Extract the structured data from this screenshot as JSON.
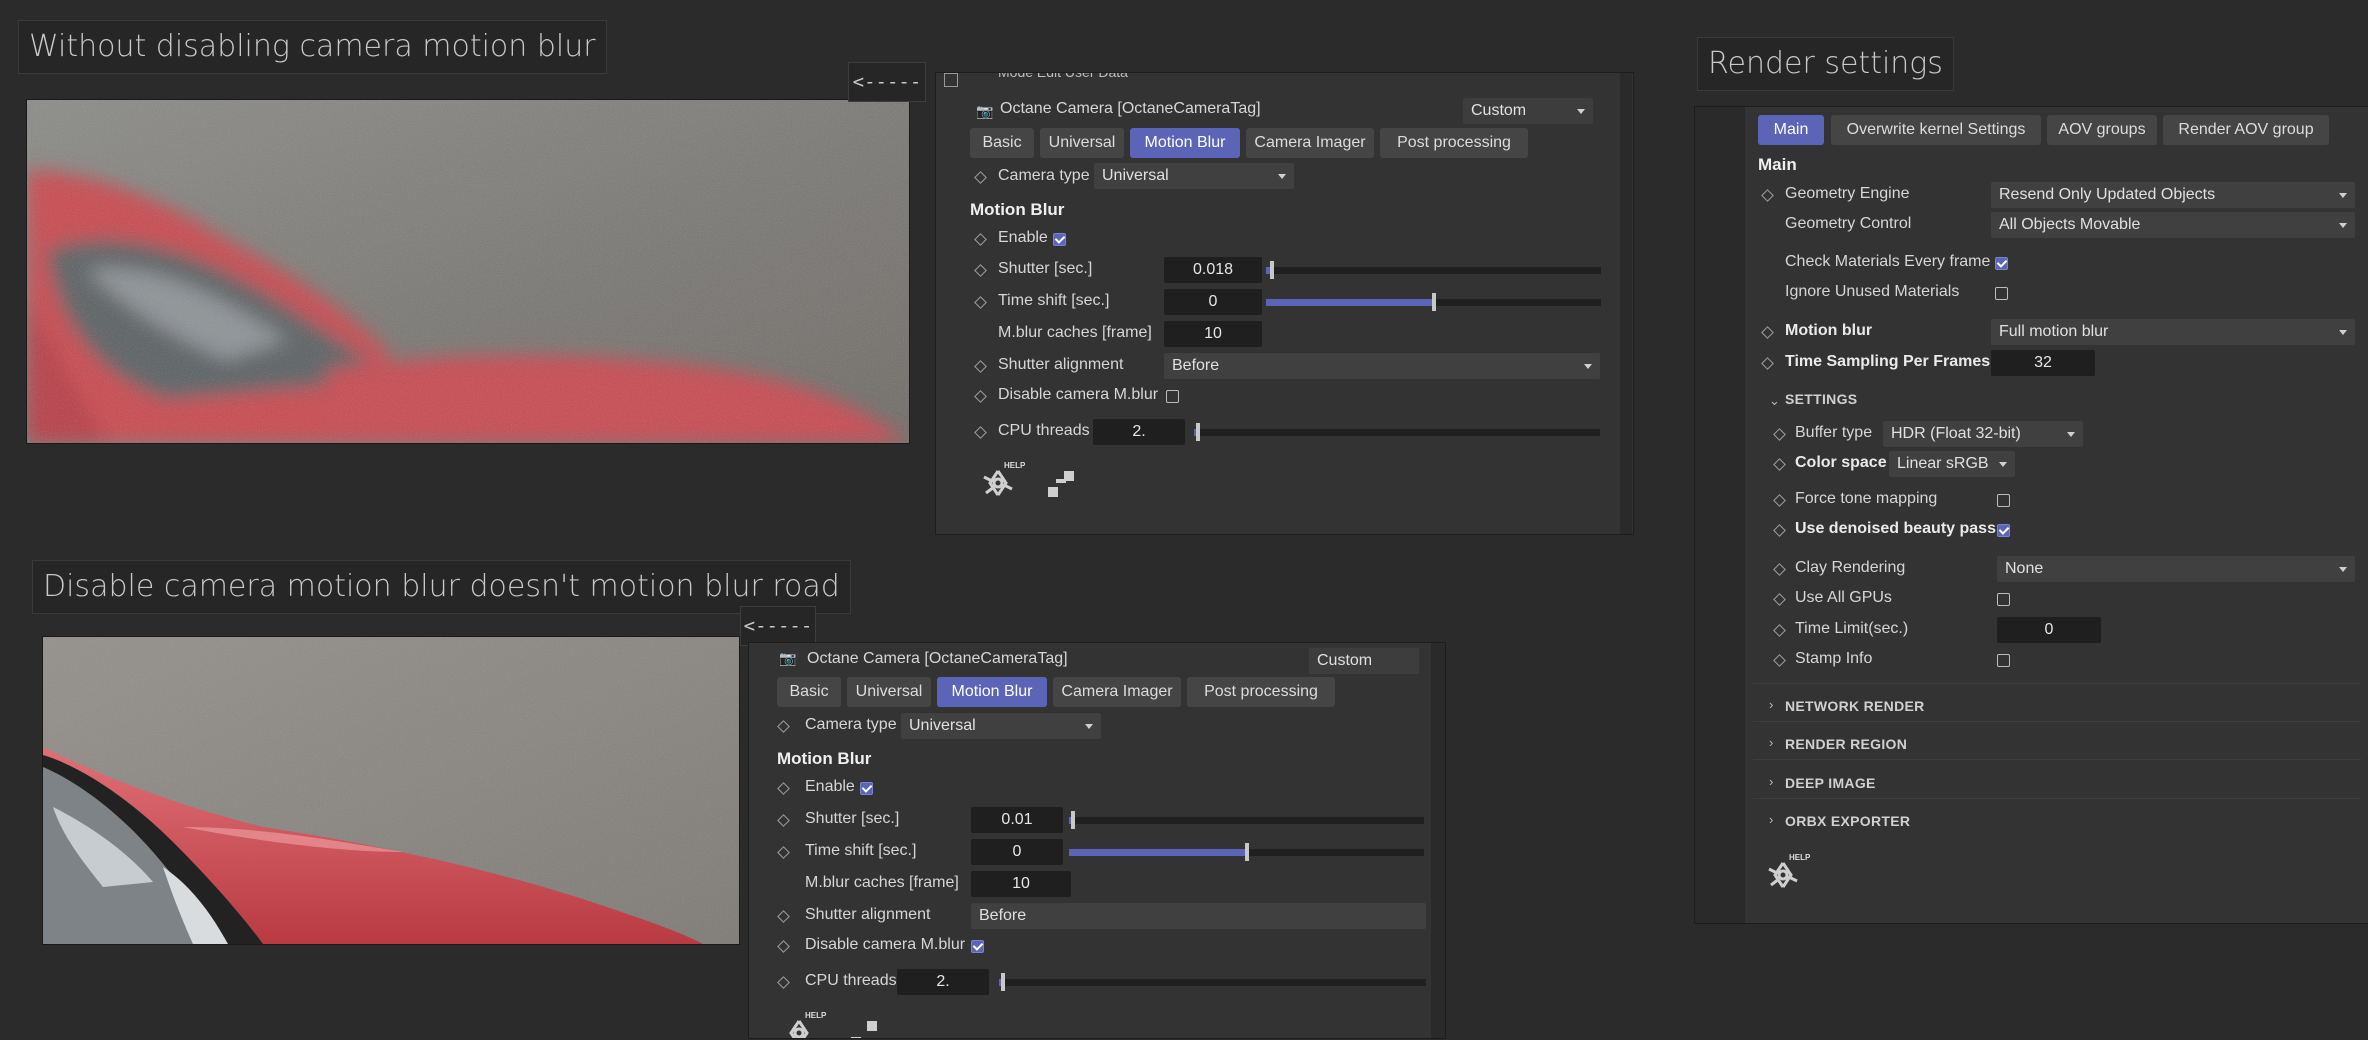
{
  "titles": {
    "top": "Without disabling camera motion blur",
    "bottom": "Disable camera motion blur doesn't motion blur road",
    "render": "Render settings"
  },
  "arrows": {
    "top": "<-----",
    "bottom": "<-----"
  },
  "top_header_fragment": "Mode   Edit   User Data",
  "camera_panel_top": {
    "tag_title": "Octane Camera [OctaneCameraTag]",
    "preset": "Custom",
    "tabs": [
      "Basic",
      "Universal",
      "Motion Blur",
      "Camera Imager",
      "Post processing"
    ],
    "active_tab": "Motion Blur",
    "camera_type_label": "Camera type",
    "camera_type_value": "Universal",
    "section": "Motion Blur",
    "enable_label": "Enable",
    "enable_checked": true,
    "shutter_label": "Shutter [sec.]",
    "shutter_value": "0.018",
    "shutter_fraction": 0.018,
    "timeshift_label": "Time shift [sec.]",
    "timeshift_value": "0",
    "timeshift_fraction": 0.5,
    "caches_label": "M.blur caches [frame]",
    "caches_value": "10",
    "alignment_label": "Shutter alignment",
    "alignment_value": "Before",
    "disable_label": "Disable camera M.blur",
    "disable_checked": false,
    "threads_label": "CPU threads",
    "threads_value": "2.",
    "threads_fraction": 0.01,
    "help_label": "HELP"
  },
  "camera_panel_bottom": {
    "tag_title": "Octane Camera [OctaneCameraTag]",
    "preset": "Custom",
    "tabs": [
      "Basic",
      "Universal",
      "Motion Blur",
      "Camera Imager",
      "Post processing"
    ],
    "active_tab": "Motion Blur",
    "camera_type_label": "Camera type",
    "camera_type_value": "Universal",
    "section": "Motion Blur",
    "enable_label": "Enable",
    "enable_checked": true,
    "shutter_label": "Shutter [sec.]",
    "shutter_value": "0.01",
    "shutter_fraction": 0.01,
    "timeshift_label": "Time shift [sec.]",
    "timeshift_value": "0",
    "timeshift_fraction": 0.5,
    "caches_label": "M.blur caches [frame]",
    "caches_value": "10",
    "alignment_label": "Shutter alignment",
    "alignment_value": "Before",
    "disable_label": "Disable camera M.blur",
    "disable_checked": true,
    "threads_label": "CPU threads",
    "threads_value": "2.",
    "threads_fraction": 0.01,
    "help_label": "HELP"
  },
  "render_panel": {
    "tabs": [
      "Main",
      "Overwrite kernel Settings",
      "AOV groups",
      "Render AOV group"
    ],
    "active_tab": "Main",
    "section": "Main",
    "geometry_engine_label": "Geometry Engine",
    "geometry_engine_value": "Resend Only Updated Objects",
    "geometry_control_label": "Geometry Control",
    "geometry_control_value": "All Objects Movable",
    "check_materials_label": "Check Materials Every frame",
    "check_materials_checked": true,
    "ignore_unused_label": "Ignore Unused Materials",
    "ignore_unused_checked": false,
    "motion_blur_label": "Motion blur",
    "motion_blur_value": "Full motion blur",
    "time_sampling_label": "Time Sampling Per Frames",
    "time_sampling_value": "32",
    "settings_head": "SETTINGS",
    "buffer_type_label": "Buffer type",
    "buffer_type_value": "HDR (Float 32-bit)",
    "color_space_label": "Color space",
    "color_space_value": "Linear sRGB",
    "force_tone_label": "Force tone mapping",
    "force_tone_checked": false,
    "denoised_label": "Use denoised beauty pass",
    "denoised_checked": true,
    "clay_label": "Clay Rendering",
    "clay_value": "None",
    "all_gpus_label": "Use All GPUs",
    "all_gpus_checked": false,
    "time_limit_label": "Time Limit(sec.)",
    "time_limit_value": "0",
    "stamp_label": "Stamp Info",
    "stamp_checked": false,
    "collapsed_sections": [
      "NETWORK RENDER",
      "RENDER REGION",
      "DEEP IMAGE",
      "ORBX EXPORTER"
    ],
    "help_label": "HELP"
  },
  "colors": {
    "accent": "#5c64b8",
    "background": "#2b2b2b",
    "panel": "#333333"
  }
}
